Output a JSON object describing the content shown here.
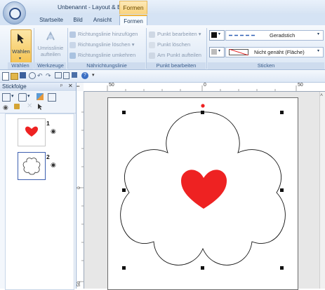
{
  "title": {
    "document": "Unbenannt - Layout & Editing",
    "context_tab": "Formen"
  },
  "tabs": [
    "Startseite",
    "Bild",
    "Ansicht",
    "Formen"
  ],
  "ribbon": {
    "waehlen": {
      "button": "Wählen",
      "group": "Wählen"
    },
    "werkzeuge": {
      "button_line1": "Umrisslinie",
      "button_line2": "aufteilen",
      "group": "Werkzeuge"
    },
    "naehrichtungslinie": {
      "items": [
        "Richtungslinie hinzufügen",
        "Richtungslinie löschen ▾",
        "Richtungslinie umkehren"
      ],
      "group": "Nährichtungslinie"
    },
    "punkt": {
      "items": [
        "Punkt bearbeiten ▾",
        "Punkt löschen",
        "Am Punkt aufteilen"
      ],
      "group": "Punkt bearbeiten"
    },
    "sticken": {
      "line_type": "Geradstich",
      "fill_type": "Nicht genäht (Fläche)",
      "group": "Sticken"
    }
  },
  "panel": {
    "title": "Stickfolge",
    "items": [
      {
        "number": "1"
      },
      {
        "number": "2"
      }
    ]
  },
  "ruler": {
    "top_labels": [
      "50",
      "0",
      "50"
    ],
    "left_labels": [
      "0",
      "50"
    ]
  },
  "colors": {
    "heart": "#ee2222",
    "accent": "#f2b740",
    "ribbon": "#dbe7f5"
  }
}
